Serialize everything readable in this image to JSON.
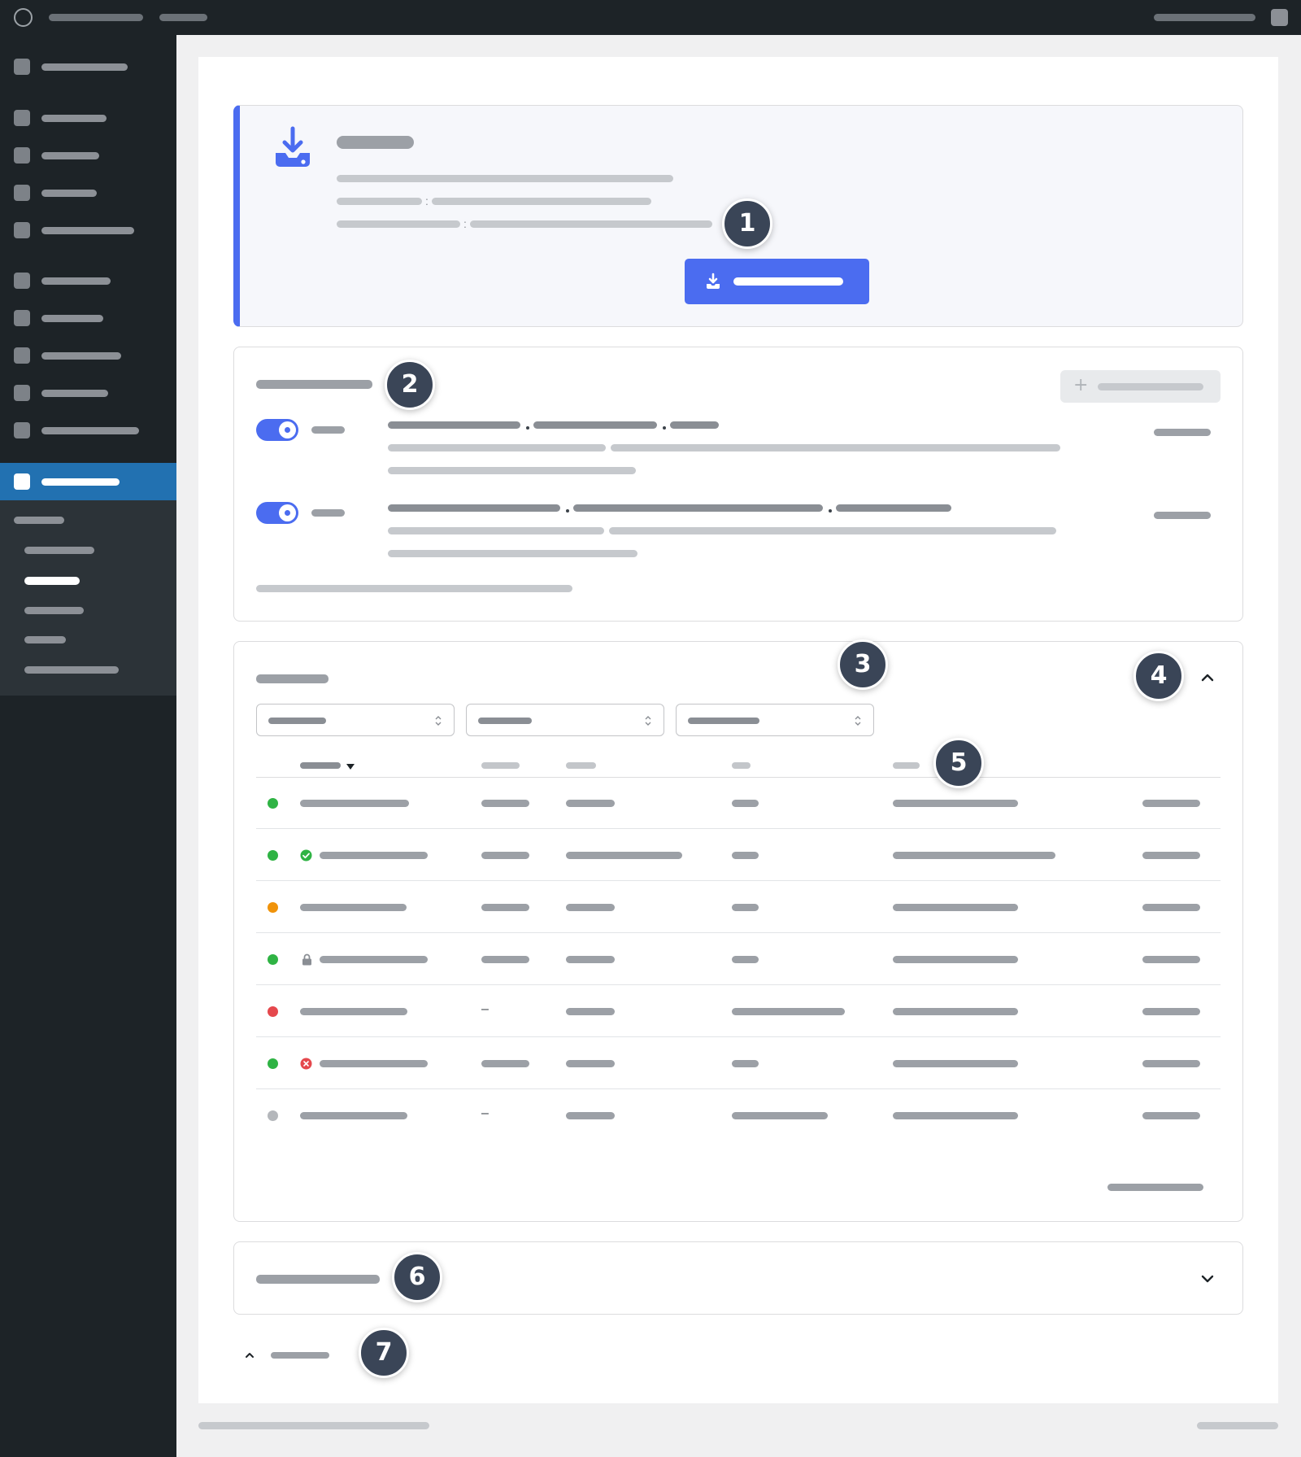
{
  "topbar": {
    "logo_icon": "wordpress-logo-icon",
    "avatar_icon": "user-avatar-icon"
  },
  "sidebar": {
    "active_color": "#2271b1",
    "items_count_visible": 11
  },
  "notice": {
    "icon": "download-tray-icon",
    "accent_color": "#4b6cf0",
    "colon_1": ":",
    "colon_2": ":",
    "button_icon": "download-icon"
  },
  "section2": {
    "add_icon": "plus-icon",
    "rules": [
      {
        "enabled": true,
        "separator_1": ".",
        "separator_2": "."
      },
      {
        "enabled": true,
        "separator_1": ".",
        "separator_2": "."
      }
    ]
  },
  "section3": {
    "collapse_icon": "chevron-up-icon",
    "sort_icon": "caret-down-icon",
    "rows": [
      {
        "status": "green",
        "icon": "",
        "col2": "value",
        "col4": "short"
      },
      {
        "status": "green",
        "icon": "check-circle-icon",
        "col2": "value",
        "col4": "short"
      },
      {
        "status": "orange",
        "icon": "",
        "col2": "value",
        "col4": "short"
      },
      {
        "status": "green",
        "icon": "lock-icon",
        "col2": "value",
        "col4": "short"
      },
      {
        "status": "red",
        "icon": "",
        "col2": "–",
        "col4": "long"
      },
      {
        "status": "green",
        "icon": "error-circle-icon",
        "col2": "value",
        "col4": "short"
      },
      {
        "status": "gray",
        "icon": "",
        "col2": "–",
        "col4": "long"
      }
    ],
    "status_colors": {
      "green": "#2fb344",
      "orange": "#f0930a",
      "red": "#e5484d",
      "gray": "#b4b7bb"
    }
  },
  "section6": {
    "expand_icon": "chevron-down-icon"
  },
  "section7": {
    "icon": "chevron-up-icon"
  },
  "badges": [
    "1",
    "2",
    "3",
    "4",
    "5",
    "6",
    "7"
  ]
}
